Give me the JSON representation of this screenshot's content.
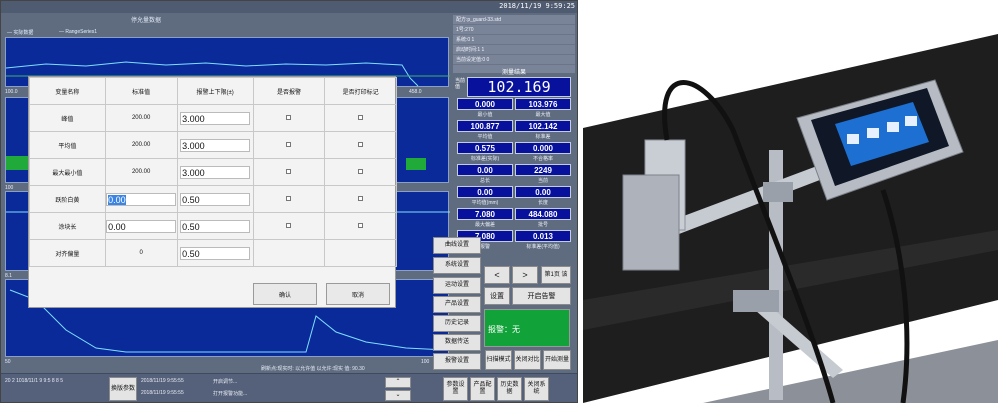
{
  "hmi": {
    "clock": "2018/11/19 9:59:25",
    "chart_title": "停允量数据",
    "legend_1": "— 实际数据",
    "legend_2": "— RangeSeries1",
    "info_lines": [
      "配方:p_guard-33.std",
      "1号:270",
      "系统:0 1",
      "启动时间:1 1",
      "当前设定值:0 0"
    ],
    "meas_title": "测量结果",
    "big_label": "当前值",
    "big_value": "102.169",
    "values": [
      {
        "v": "0.000",
        "l": "最小值"
      },
      {
        "v": "103.976",
        "l": "最大值"
      },
      {
        "v": "100.877",
        "l": "平均值"
      },
      {
        "v": "102.142",
        "l": "标准差"
      },
      {
        "v": "0.575",
        "l": "标准差(实际)"
      },
      {
        "v": "0.000",
        "l": "不合格率"
      },
      {
        "v": "0.00",
        "l": "总长"
      },
      {
        "v": "2249",
        "l": "当前"
      },
      {
        "v": "0.00",
        "l": "平均值(mm)"
      },
      {
        "v": "0.00",
        "l": "长度"
      },
      {
        "v": "7.080",
        "l": "最大偏差"
      },
      {
        "v": "484.080",
        "l": "批号"
      },
      {
        "v": "7.080",
        "l": "报警"
      },
      {
        "v": "0.013",
        "l": "标准差(平均值)"
      }
    ],
    "axis_labels": [
      "100.0",
      "458.0",
      "100",
      "8.1",
      "50",
      "100"
    ],
    "nav": {
      "prev": "<",
      "next": ">",
      "first_page": "第1页 该"
    },
    "side_menu": [
      "曲线设置",
      "系统设置",
      "运动设置",
      "产品设置",
      "历史记录",
      "数据传送",
      "报警设置"
    ],
    "reset_button": "设置",
    "start_alarm_button": "开启告警",
    "status_label": "报警：无",
    "bottom_buttons": [
      {
        "label": "扫描模式"
      },
      {
        "label": "关闭对比"
      },
      {
        "label": "开始测量"
      },
      {
        "label": "换版参数"
      },
      {
        "label": "参数设置"
      },
      {
        "label": "产品配置"
      },
      {
        "label": "历史数据"
      },
      {
        "label": "关闭系统"
      }
    ],
    "bottom_left_text": "20 2 1018/11/1 9 9:5 8 8 5",
    "log_lines": [
      "2018/11/19 9:55:55",
      "2018/11/19 9:55:55"
    ],
    "log_msgs": [
      "开启调节...",
      "打开报警功能..."
    ],
    "bottom_chart_text": "刷新点:现实时: 以允许值 以允许:现实 值: 90.30"
  },
  "dialog": {
    "headers": [
      "变量名称",
      "标准值",
      "报警上下限(±)",
      "是否报警",
      "是否打印标记"
    ],
    "rows": [
      {
        "name": "峰值",
        "std": "200.00",
        "limit1": "3.000",
        "limit2": ""
      },
      {
        "name": "平均值",
        "std": "200.00",
        "limit1": "3.000",
        "limit2": ""
      },
      {
        "name": "最大最小值",
        "std": "200.00",
        "limit1": "3.000",
        "limit2": ""
      },
      {
        "name": "跃阶白黄",
        "std": "",
        "limit1": "0.00",
        "limit2": "0.50"
      },
      {
        "name": "涂块长",
        "std": "",
        "limit1": "0.00",
        "limit2": "0.50"
      },
      {
        "name": "对齐偏量",
        "std": "0",
        "limit1": "",
        "limit2": "0.50"
      }
    ],
    "confirm": "确认",
    "cancel": "取消"
  }
}
